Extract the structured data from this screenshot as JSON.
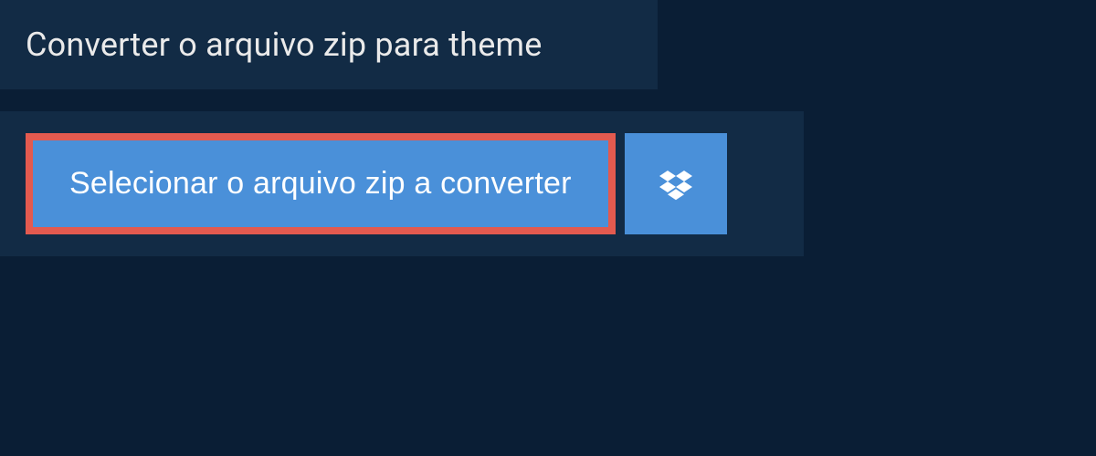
{
  "header": {
    "title": "Converter o arquivo zip para theme"
  },
  "buttons": {
    "select_label": "Selecionar o arquivo zip a converter"
  }
}
